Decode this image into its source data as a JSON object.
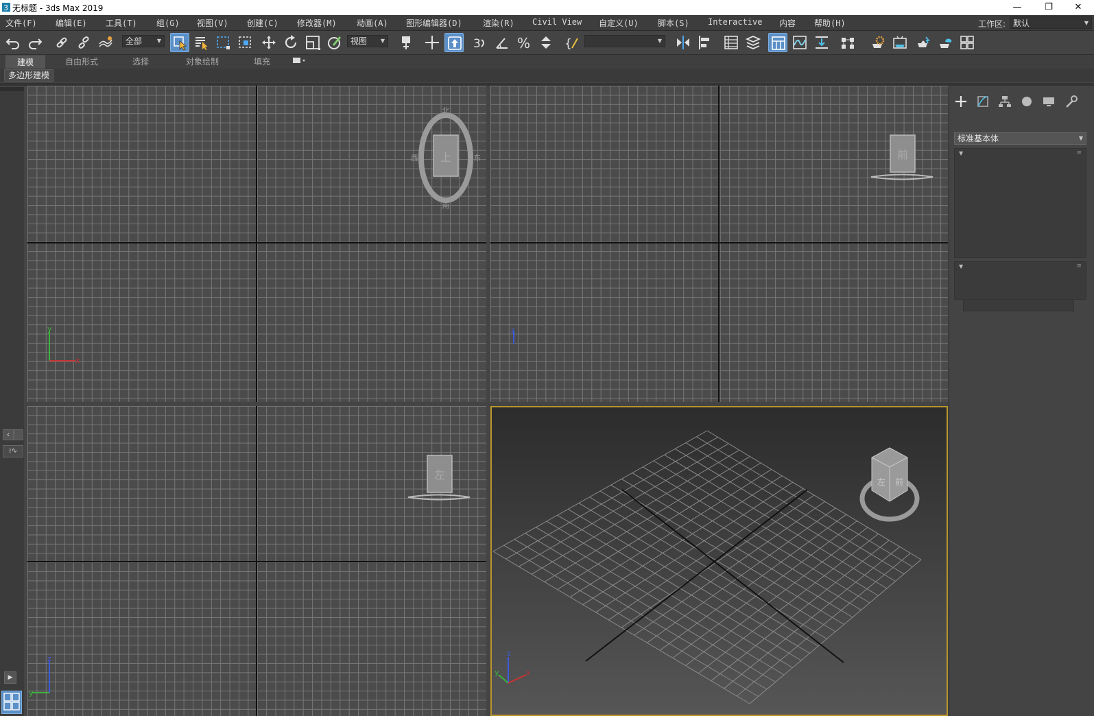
{
  "window": {
    "title": "无标题 - 3ds Max 2019",
    "minimize": "—",
    "restore": "❐",
    "close": "✕"
  },
  "menu": {
    "items": [
      {
        "label": "文件(F)"
      },
      {
        "label": "编辑(E)"
      },
      {
        "label": "工具(T)"
      },
      {
        "label": "组(G)"
      },
      {
        "label": "视图(V)"
      },
      {
        "label": "创建(C)"
      },
      {
        "label": "修改器(M)"
      },
      {
        "label": "动画(A)"
      },
      {
        "label": "图形编辑器(D)"
      },
      {
        "label": "渲染(R)"
      },
      {
        "label": "Civil View"
      },
      {
        "label": "自定义(U)"
      },
      {
        "label": "脚本(S)"
      },
      {
        "label": "Interactive"
      },
      {
        "label": "内容"
      },
      {
        "label": "帮助(H)"
      }
    ],
    "workspace_label": "工作区:",
    "workspace_value": "默认"
  },
  "toolbar": {
    "selection_filter": "全部",
    "ref_coord": "视图",
    "named_selection": ""
  },
  "ribbon": {
    "tabs": [
      "建模",
      "自由形式",
      "选择",
      "对象绘制",
      "填充"
    ],
    "active_tab": "建模",
    "subtab": "多边形建模"
  },
  "viewcube": {
    "top_face": "上",
    "front_face": "前",
    "left_face": "左",
    "compass_n": "北",
    "compass_s": "南",
    "compass_e": "东",
    "compass_w": "西"
  },
  "axes": {
    "x": "x",
    "y": "y",
    "z": "z"
  },
  "command_panel": {
    "category": "标准基本体"
  },
  "colors": {
    "accent": "#5b8fc7",
    "active_viewport_border": "#b8962e",
    "axis_x": "#c83232",
    "axis_y": "#3cb43c",
    "axis_z": "#3c5adc"
  }
}
